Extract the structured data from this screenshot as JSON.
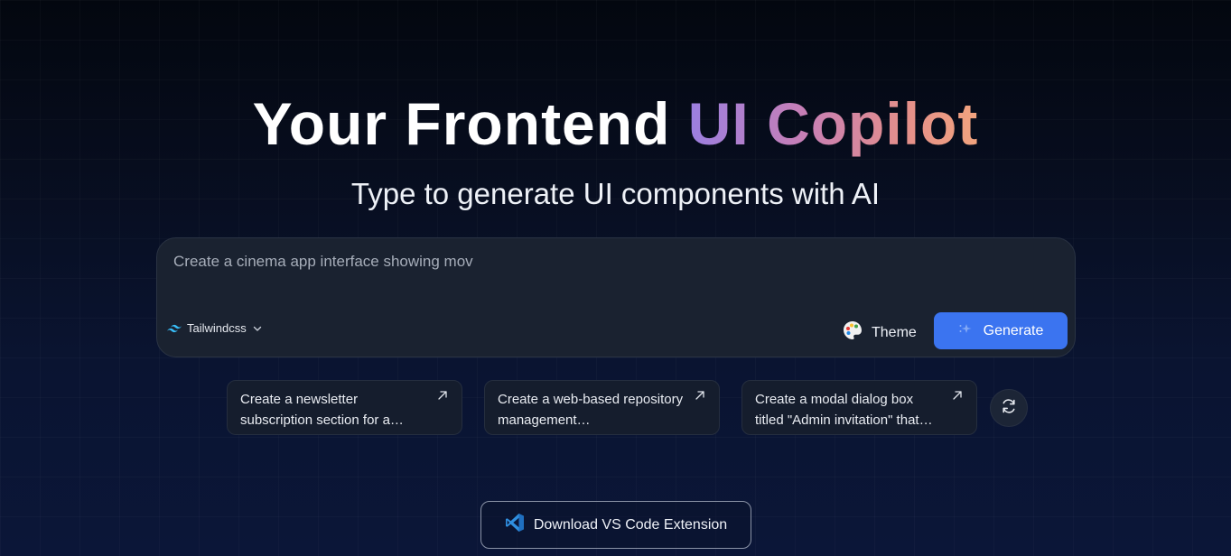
{
  "hero": {
    "title_plain": "Your Frontend",
    "title_gradient": "UI Copilot",
    "subtitle": "Type to generate UI components with AI"
  },
  "prompt": {
    "value": "Create a cinema app interface showing mov",
    "framework_label": "Tailwindcss",
    "framework_icon": "tailwind-icon",
    "theme_label": "Theme",
    "theme_icon": "palette-icon",
    "generate_label": "Generate",
    "generate_icon": "sparkle-icon"
  },
  "suggestions": [
    {
      "text": "Create a newsletter subscription section for a…",
      "icon": "arrow-up-right-icon"
    },
    {
      "text": "Create a web-based repository management…",
      "icon": "arrow-up-right-icon"
    },
    {
      "text": "Create a modal dialog box titled \"Admin invitation\" that…",
      "icon": "arrow-up-right-icon"
    }
  ],
  "refresh_icon": "refresh-icon",
  "vscode": {
    "label": "Download VS Code Extension",
    "icon": "vscode-icon"
  },
  "colors": {
    "accent": "#3b74f0",
    "gradient_start": "#9b7fe0",
    "gradient_end": "#f2a47e",
    "card_bg": "#1a2230"
  }
}
